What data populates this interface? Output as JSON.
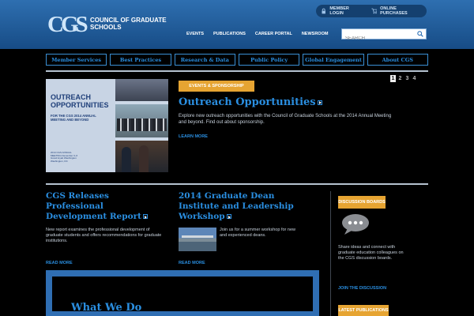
{
  "header": {
    "logo_mark_left": "CG",
    "logo_mark_right": "S",
    "logo_text": "COUNCIL OF GRADUATE SCHOOLS",
    "utility": {
      "member_login": "MEMBER LOGIN",
      "online_purchases": "ONLINE PURCHASES"
    },
    "nav": [
      "EVENTS",
      "PUBLICATIONS",
      "CAREER PORTAL",
      "NEWSROOM"
    ],
    "search_placeholder": "SEARCH"
  },
  "section_nav": [
    "Member Services",
    "Best Practices",
    "Research & Data",
    "Public Policy",
    "Global Engagement",
    "About CGS"
  ],
  "feature": {
    "image_title": "OUTREACH OPPORTUNITIES",
    "image_subtitle": "FOR THE CGS 2014 ANNUAL MEETING AND BEYOND",
    "image_footer": "2014 CGS ANNUAL MEETING December 3–6 Grand Hyatt Washington Washington, DC",
    "badge": "EVENTS & SPONSORSHIP",
    "title": "Outreach Opportunities",
    "body": "Explore new outreach opportunities with the Council of Graduate Schools at the 2014 Annual Meeting and beyond. Find out about sponsorship.",
    "more": "LEARN MORE",
    "pager": [
      "1",
      "2",
      "3",
      "4"
    ]
  },
  "col1": {
    "title": "CGS Releases Professional Development Report",
    "body": "New report examines the professional development of graduate students and offers recommendations for graduate institutions.",
    "more": "READ MORE"
  },
  "col2": {
    "title": "2014 Graduate Dean Institute and Leadership Workshop",
    "body": "Join us for a summer workshop for new and experienced deans.",
    "more": "READ MORE"
  },
  "sidebar": {
    "discussion_badge": "DISCUSSION BOARDS",
    "body": "Share ideas and connect with graduate education colleagues on the CGS discussion boards.",
    "more": "JOIN THE DISCUSSION",
    "publications_badge": "LATEST PUBLICATIONS"
  },
  "whatwedo": {
    "title": "What We Do"
  },
  "colors": {
    "header_top": "#2e6fb0",
    "accent_blue": "#2a8ee0",
    "badge_orange": "#e6a432"
  }
}
